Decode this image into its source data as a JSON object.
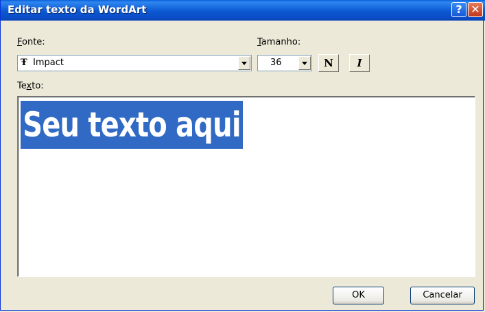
{
  "window": {
    "title": "Editar texto da WordArt"
  },
  "titlebar": {
    "help_label": "?",
    "close_label": "✕"
  },
  "font": {
    "label_accel": "F",
    "label_rest": "onte:",
    "value": "Impact",
    "icon": "truetype-font-icon",
    "icon_glyph": "Ŧ"
  },
  "size": {
    "label_accel": "T",
    "label_rest": "amanho:",
    "value": "36"
  },
  "format": {
    "bold_label": "N",
    "italic_label": "I"
  },
  "text": {
    "label_pre": "Te",
    "label_accel": "x",
    "label_post": "to:",
    "value": "Seu texto aqui"
  },
  "buttons": {
    "ok": "OK",
    "cancel": "Cancelar"
  },
  "colors": {
    "titlebar": "#0a58d2",
    "selection": "#316ac5",
    "dialog_bg": "#ece9d8"
  }
}
